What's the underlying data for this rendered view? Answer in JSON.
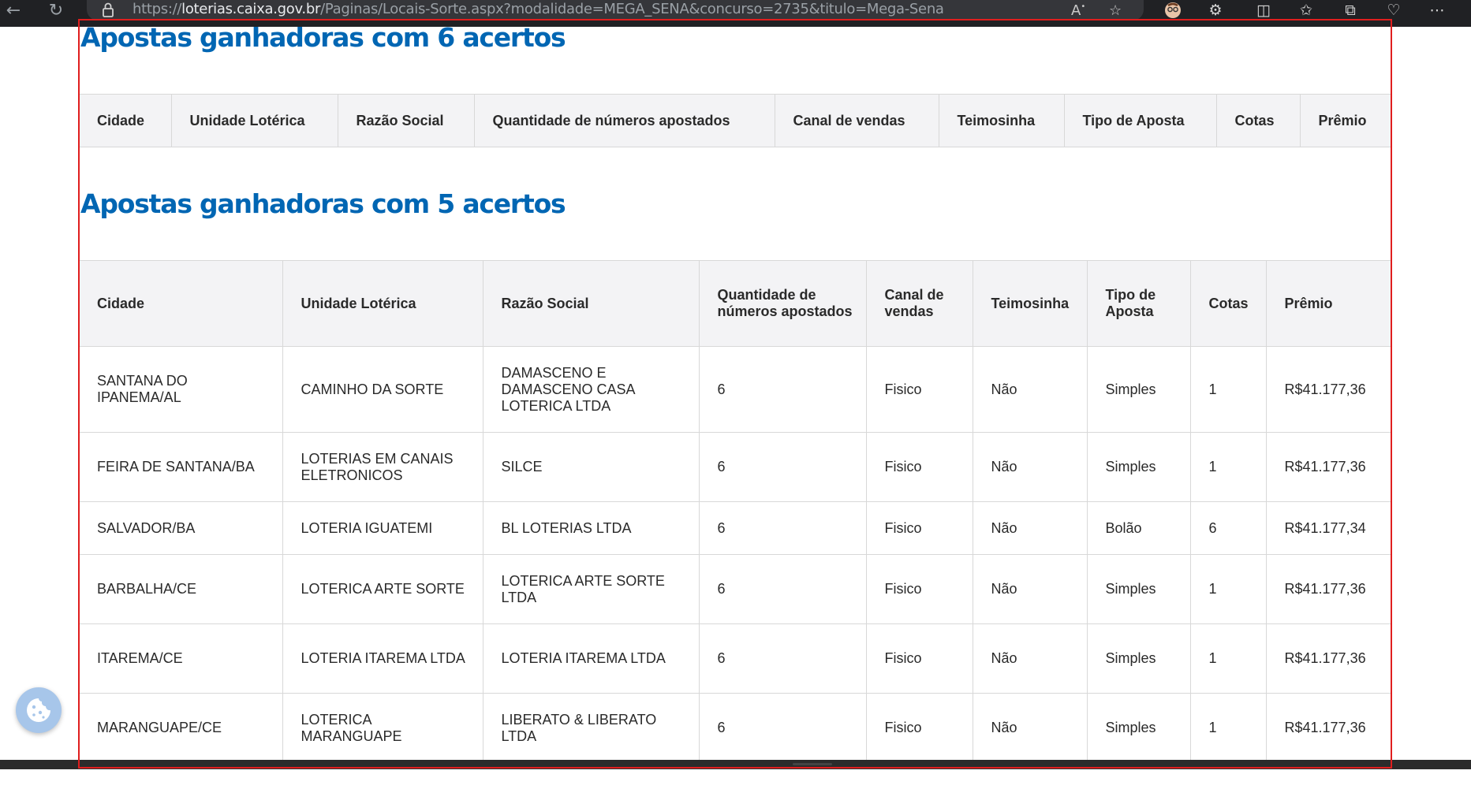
{
  "browser": {
    "url_prefix": "https://",
    "url_domain": "loterias.caixa.gov.br",
    "url_path": "/Paginas/Locais-Sorte.aspx?modalidade=MEGA_SENA&concurso=2735&titulo=Mega-Sena",
    "read_aloud_label": "A",
    "icons": [
      "back-icon",
      "refresh-icon",
      "lock-icon",
      "read-aloud-icon",
      "favorite-star-icon",
      "profile-avatar-icon",
      "extensions-icon",
      "split-screen-icon",
      "favorites-icon",
      "collections-icon",
      "browser-essentials-icon",
      "more-icon"
    ]
  },
  "sections": [
    {
      "title": "Apostas ganhadoras com 6 acertos",
      "columns": [
        "Cidade",
        "Unidade Lotérica",
        "Razão Social",
        "Quantidade de números apostados",
        "Canal de vendas",
        "Teimosinha",
        "Tipo de Aposta",
        "Cotas",
        "Prêmio"
      ],
      "rows": []
    },
    {
      "title": "Apostas ganhadoras com 5 acertos",
      "columns": [
        "Cidade",
        "Unidade Lotérica",
        "Razão Social",
        "Quantidade de números apostados",
        "Canal de vendas",
        "Teimosinha",
        "Tipo de Aposta",
        "Cotas",
        "Prêmio"
      ],
      "rows": [
        [
          "SANTANA DO IPANEMA/AL",
          "CAMINHO DA SORTE",
          "DAMASCENO E DAMASCENO CASA LOTERICA LTDA",
          "6",
          "Fisico",
          "Não",
          "Simples",
          "1",
          "R$41.177,36"
        ],
        [
          "FEIRA DE SANTANA/BA",
          "LOTERIAS EM CANAIS ELETRONICOS",
          "SILCE",
          "6",
          "Fisico",
          "Não",
          "Simples",
          "1",
          "R$41.177,36"
        ],
        [
          "SALVADOR/BA",
          "LOTERIA IGUATEMI",
          "BL LOTERIAS LTDA",
          "6",
          "Fisico",
          "Não",
          "Bolão",
          "6",
          "R$41.177,34"
        ],
        [
          "BARBALHA/CE",
          "LOTERICA ARTE SORTE",
          "LOTERICA ARTE SORTE LTDA",
          "6",
          "Fisico",
          "Não",
          "Simples",
          "1",
          "R$41.177,36"
        ],
        [
          "ITAREMA/CE",
          "LOTERIA ITAREMA LTDA",
          "LOTERIA ITAREMA LTDA",
          "6",
          "Fisico",
          "Não",
          "Simples",
          "1",
          "R$41.177,36"
        ],
        [
          "MARANGUAPE/CE",
          "LOTERICA MARANGUAPE",
          "LIBERATO & LIBERATO LTDA",
          "6",
          "Fisico",
          "Não",
          "Simples",
          "1",
          "R$41.177,36"
        ]
      ]
    }
  ],
  "colors": {
    "title_blue": "#0066b3",
    "header_bg": "#f3f3f5",
    "frame_red": "#e01e1e",
    "cookie_button": "#a7c6ea"
  },
  "cookie_button": {
    "icon": "cookie-icon"
  }
}
